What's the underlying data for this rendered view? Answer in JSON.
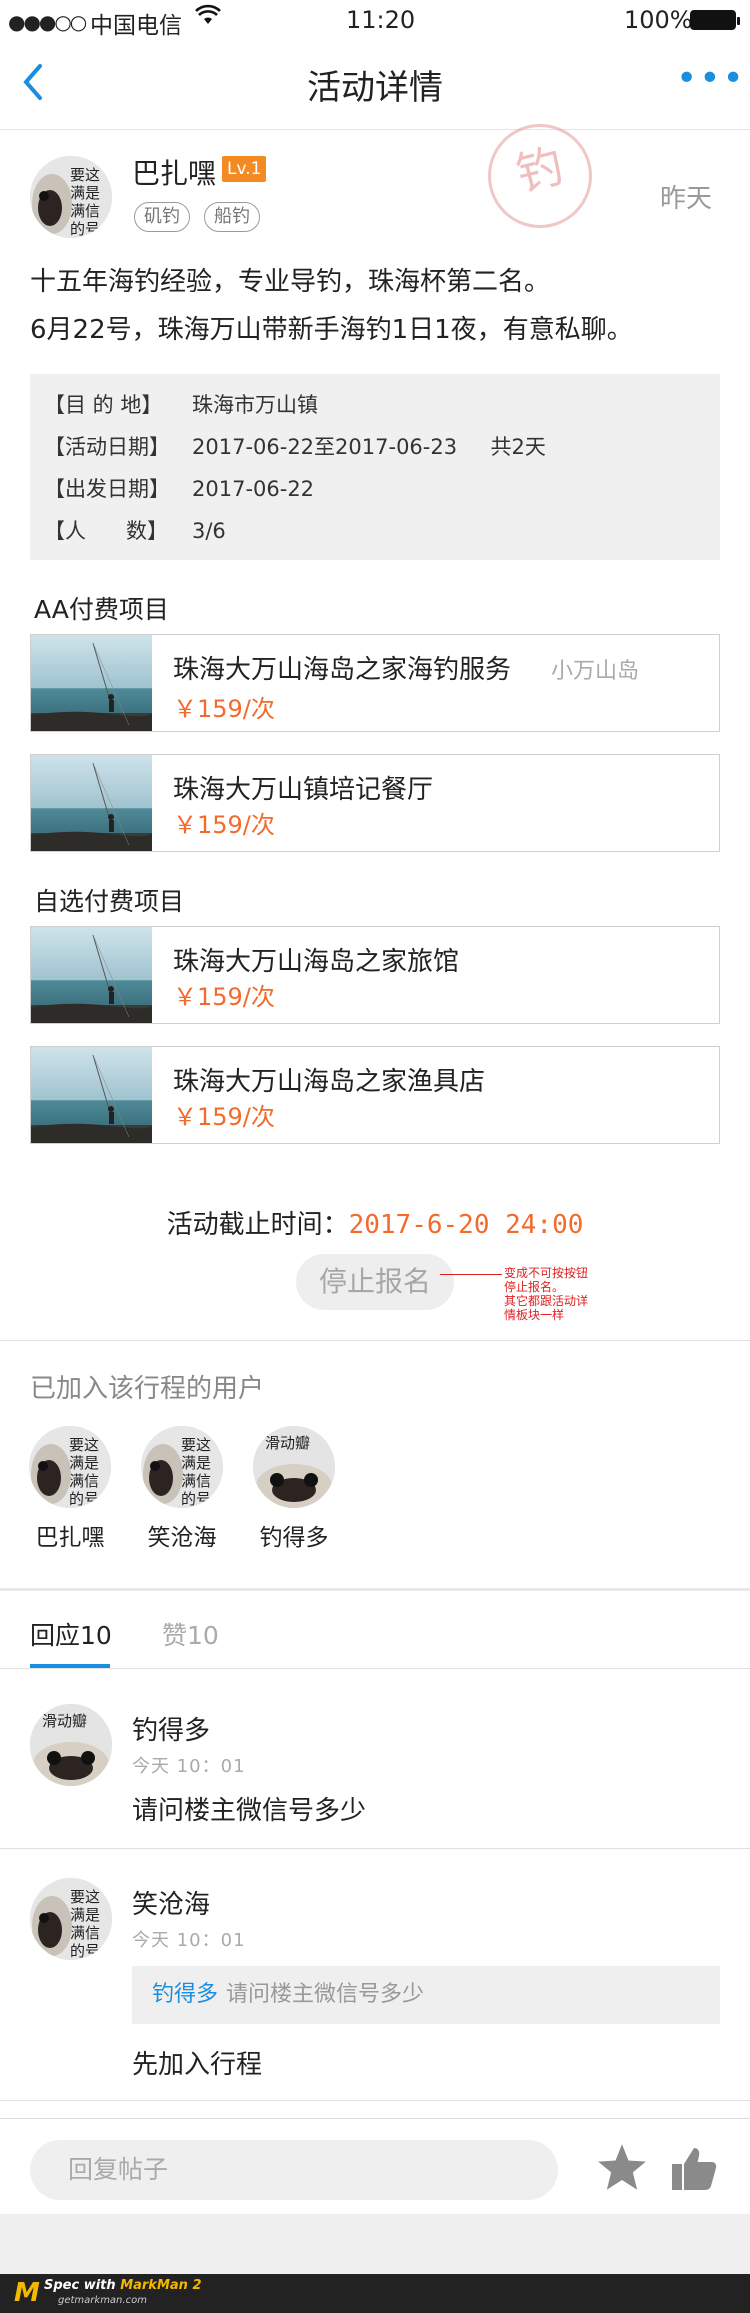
{
  "status": {
    "signal": "●●●○○",
    "carrier": "中国电信",
    "wifi": "wifi-icon",
    "time": "11:20",
    "battery": "100%"
  },
  "nav": {
    "back_icon": "chevron-left-icon",
    "title": "活动详情",
    "more": "•••"
  },
  "post": {
    "author": "巴扎嘿",
    "level": "Lv.1",
    "tags": [
      "矶钓",
      "船钓"
    ],
    "stamp": "钓",
    "time": "昨天",
    "desc": [
      "十五年海钓经验，专业导钓，珠海杯第二名。",
      "6月22号，珠海万山带新手海钓1日1夜，有意私聊。"
    ]
  },
  "info": [
    {
      "key": "【目 的 地】",
      "value": "珠海市万山镇"
    },
    {
      "key": "【活动日期】",
      "value": "2017-06-22至2017-06-23     共2天"
    },
    {
      "key": "【出发日期】",
      "value": "2017-06-22"
    },
    {
      "key": "【人      数】",
      "value": "3/6"
    }
  ],
  "aa_title": "AA付费项目",
  "aa_items": [
    {
      "name": "珠海大万山海岛之家海钓服务",
      "price": "￥159/次",
      "location": "小万山岛"
    },
    {
      "name": "珠海大万山镇培记餐厅",
      "price": "￥159/次"
    }
  ],
  "optional_title": "自选付费项目",
  "optional_items": [
    {
      "name": "珠海大万山海岛之家旅馆",
      "price": "￥159/次"
    },
    {
      "name": "珠海大万山海岛之家渔具店",
      "price": "￥159/次"
    }
  ],
  "deadline": {
    "label": "活动截止时间：",
    "value": "2017-6-20 24:00"
  },
  "stop_button": "停止报名",
  "annotation": "变成不可按按钮\n停止报名。\n其它都跟活动详\n情板块一样",
  "joined": {
    "title": "已加入该行程的用户",
    "members": [
      "巴扎嘿",
      "笑沧海",
      "钓得多"
    ]
  },
  "tabs": {
    "replies": "回应10",
    "likes": "赞10"
  },
  "comments": [
    {
      "name": "钓得多",
      "time": "今天 10：01",
      "text": "请问楼主微信号多少"
    },
    {
      "name": "笑沧海",
      "time": "今天 10：01",
      "quote_name": "钓得多",
      "quote_text": "请问楼主微信号多少",
      "text": "先加入行程"
    }
  ],
  "reply": {
    "placeholder": "回复帖子",
    "star_icon": "star-icon",
    "like_icon": "thumbs-up-icon"
  },
  "markman": {
    "logo": "M",
    "text1": "Spec with ",
    "text2": "MarkMan 2",
    "sub": "getmarkman.com"
  },
  "colors": {
    "accent": "#1a8fe0",
    "price": "#f36b2c",
    "level": "#f48b22",
    "annotation": "#e02020"
  }
}
